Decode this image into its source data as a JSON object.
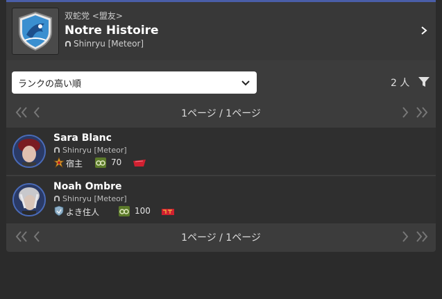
{
  "free_company": {
    "grand_company": "双蛇党 <盟友>",
    "name": "Notre Histoire",
    "world": "Shinryu [Meteor]"
  },
  "controls": {
    "sort_selected": "ランクの高い順",
    "member_count": "2 人"
  },
  "pagination": {
    "label": "1ページ / 1ページ"
  },
  "members": [
    {
      "name": "Sara Blanc",
      "world": "Shinryu [Meteor]",
      "rank": "宿主",
      "rank_icon": "rank-crown-icon",
      "level": "70",
      "job_icon": "red-job-icon"
    },
    {
      "name": "Noah Ombre",
      "world": "Shinryu [Meteor]",
      "rank": "よき住人",
      "rank_icon": "rank-shield-icon",
      "level": "100",
      "job_icon": "red-job-icon"
    }
  ],
  "colors": {
    "accent_line": "#4a5ea8",
    "panel": "#3c3c3c",
    "level_badge": "#5c7a2a",
    "job_red": "#d02030"
  }
}
